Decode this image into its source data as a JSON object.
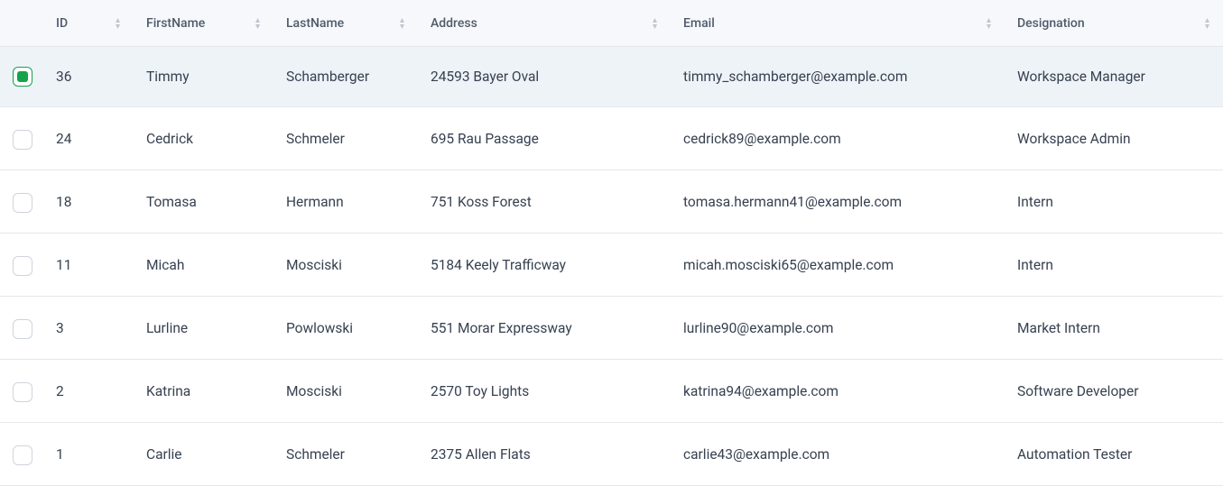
{
  "columns": {
    "id": "ID",
    "firstName": "FirstName",
    "lastName": "LastName",
    "address": "Address",
    "email": "Email",
    "designation": "Designation"
  },
  "rows": [
    {
      "selected": true,
      "id": "36",
      "firstName": "Timmy",
      "lastName": "Schamberger",
      "address": "24593 Bayer Oval",
      "email": "timmy_schamberger@example.com",
      "designation": "Workspace Manager"
    },
    {
      "selected": false,
      "id": "24",
      "firstName": "Cedrick",
      "lastName": "Schmeler",
      "address": "695 Rau Passage",
      "email": "cedrick89@example.com",
      "designation": "Workspace Admin"
    },
    {
      "selected": false,
      "id": "18",
      "firstName": "Tomasa",
      "lastName": "Hermann",
      "address": "751 Koss Forest",
      "email": "tomasa.hermann41@example.com",
      "designation": "Intern"
    },
    {
      "selected": false,
      "id": "11",
      "firstName": "Micah",
      "lastName": "Mosciski",
      "address": "5184 Keely Trafficway",
      "email": "micah.mosciski65@example.com",
      "designation": "Intern"
    },
    {
      "selected": false,
      "id": "3",
      "firstName": "Lurline",
      "lastName": "Powlowski",
      "address": "551 Morar Expressway",
      "email": "lurline90@example.com",
      "designation": "Market Intern"
    },
    {
      "selected": false,
      "id": "2",
      "firstName": "Katrina",
      "lastName": "Mosciski",
      "address": "2570 Toy Lights",
      "email": "katrina94@example.com",
      "designation": "Software Developer"
    },
    {
      "selected": false,
      "id": "1",
      "firstName": "Carlie",
      "lastName": "Schmeler",
      "address": "2375 Allen Flats",
      "email": "carlie43@example.com",
      "designation": "Automation Tester"
    }
  ]
}
